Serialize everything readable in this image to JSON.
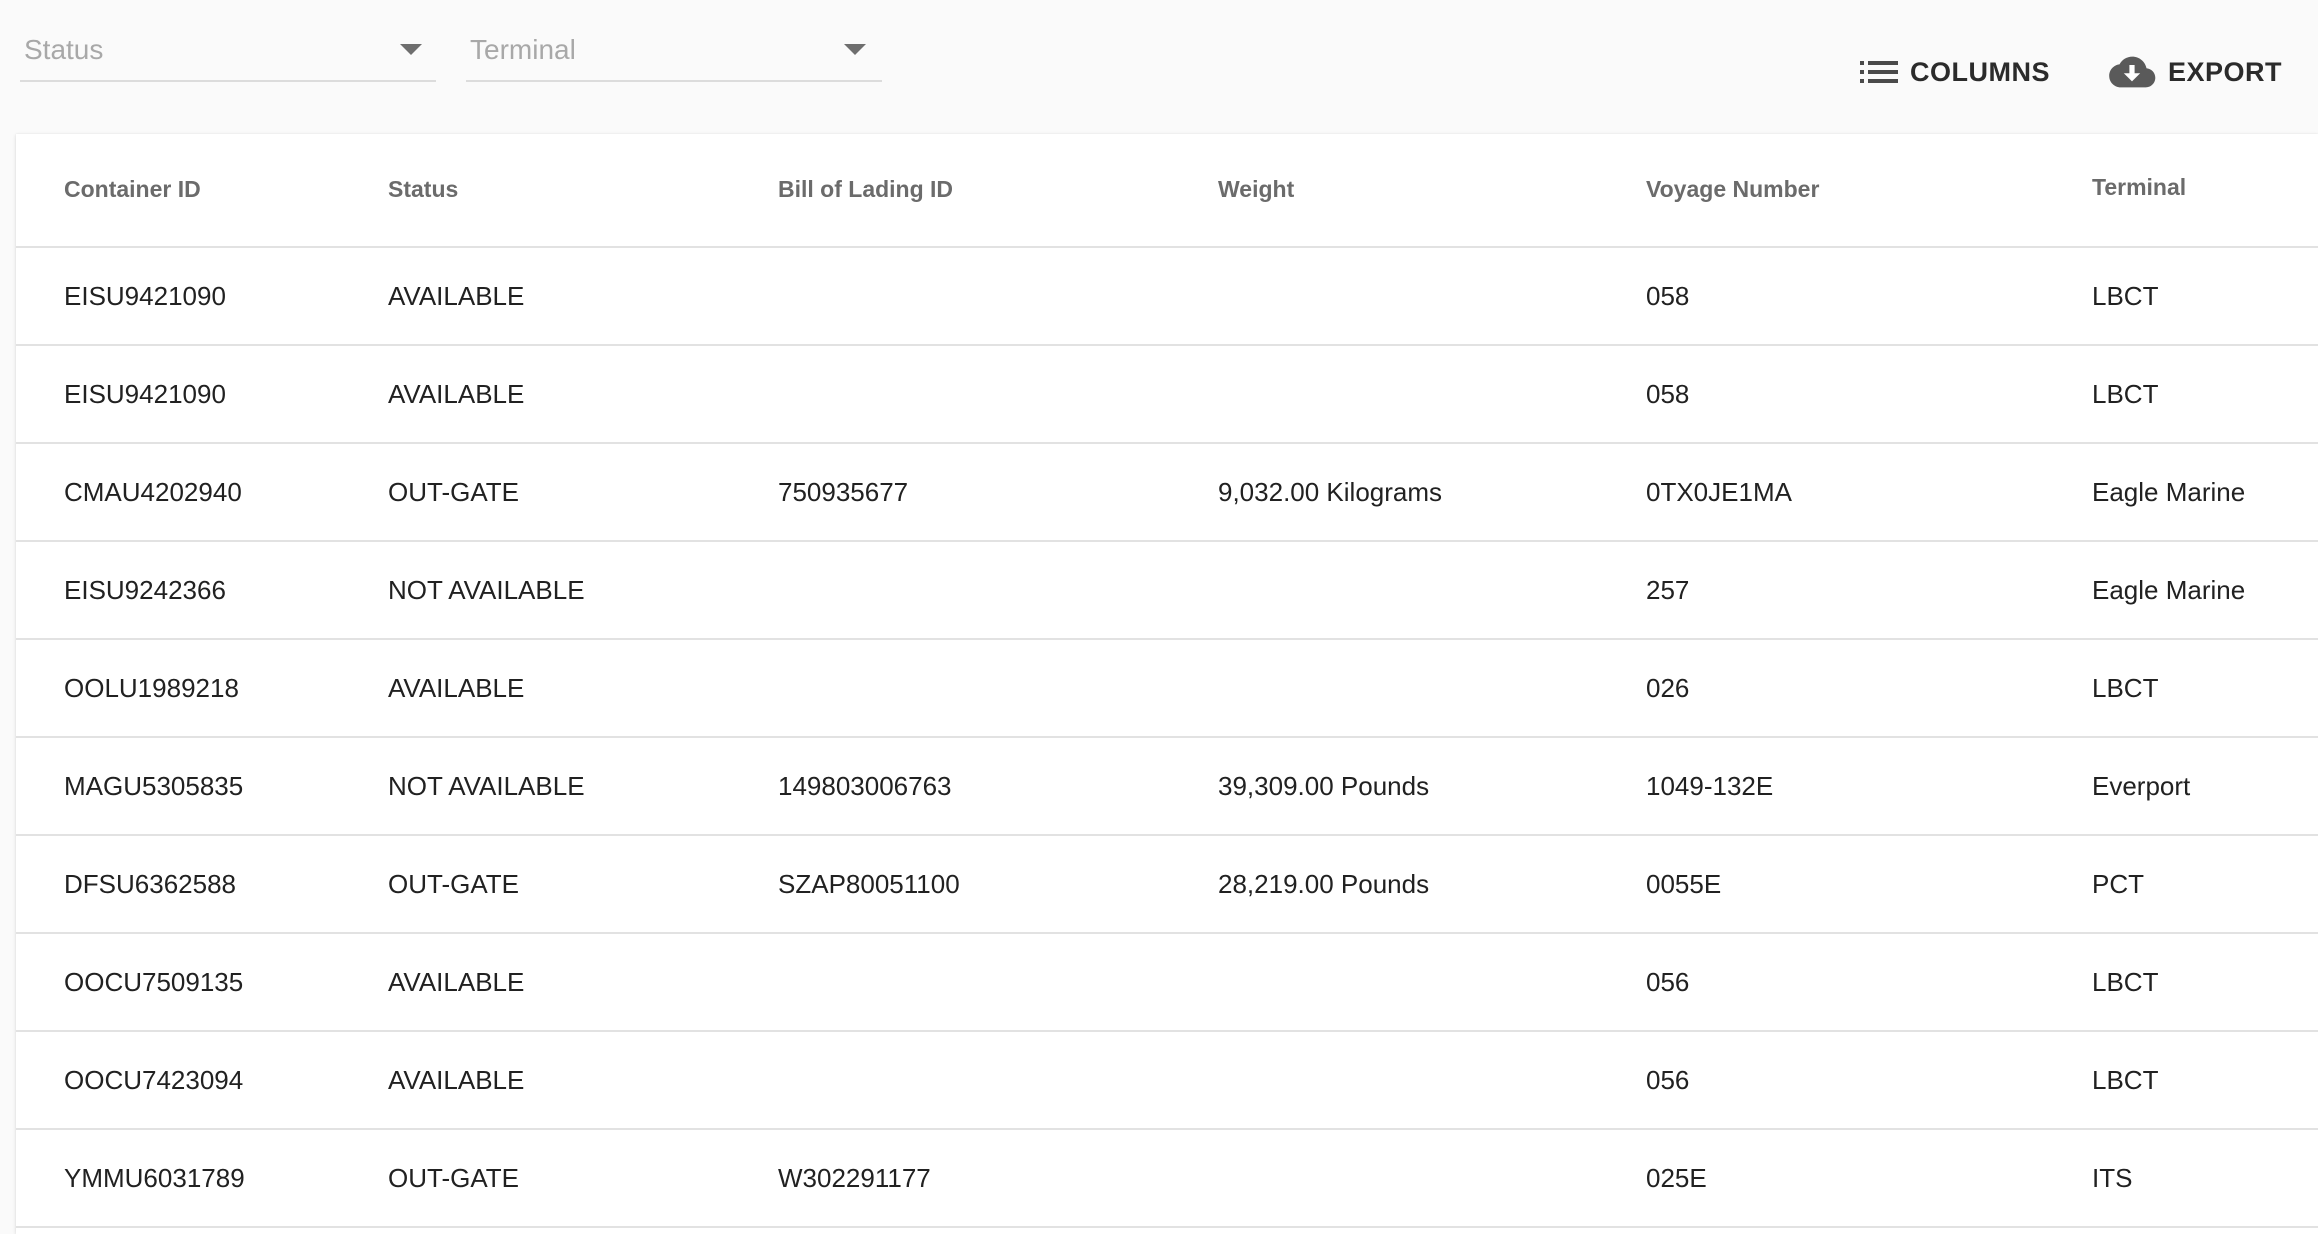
{
  "filters": {
    "status": {
      "placeholder": "Status"
    },
    "terminal": {
      "placeholder": "Terminal"
    }
  },
  "toolbar": {
    "columns_label": "COLUMNS",
    "export_label": "EXPORT",
    "columns_icon": "list-icon",
    "export_icon": "cloud-download-icon"
  },
  "table": {
    "columns": [
      "Container ID",
      "Status",
      "Bill of Lading ID",
      "Weight",
      "Voyage Number",
      "Terminal"
    ],
    "rows": [
      [
        "EISU9421090",
        "AVAILABLE",
        "",
        "",
        "058",
        "LBCT"
      ],
      [
        "EISU9421090",
        "AVAILABLE",
        "",
        "",
        "058",
        "LBCT"
      ],
      [
        "CMAU4202940",
        "OUT-GATE",
        "750935677",
        "9,032.00 Kilograms",
        "0TX0JE1MA",
        "Eagle Marine"
      ],
      [
        "EISU9242366",
        "NOT AVAILABLE",
        "",
        "",
        "257",
        "Eagle Marine"
      ],
      [
        "OOLU1989218",
        "AVAILABLE",
        "",
        "",
        "026",
        "LBCT"
      ],
      [
        "MAGU5305835",
        "NOT AVAILABLE",
        "149803006763",
        "39,309.00 Pounds",
        "1049-132E",
        "Everport"
      ],
      [
        "DFSU6362588",
        "OUT-GATE",
        "SZAP80051100",
        "28,219.00 Pounds",
        "0055E",
        "PCT"
      ],
      [
        "OOCU7509135",
        "AVAILABLE",
        "",
        "",
        "056",
        "LBCT"
      ],
      [
        "OOCU7423094",
        "AVAILABLE",
        "",
        "",
        "056",
        "LBCT"
      ],
      [
        "YMMU6031789",
        "OUT-GATE",
        "W302291177",
        "",
        "025E",
        "ITS"
      ]
    ]
  }
}
